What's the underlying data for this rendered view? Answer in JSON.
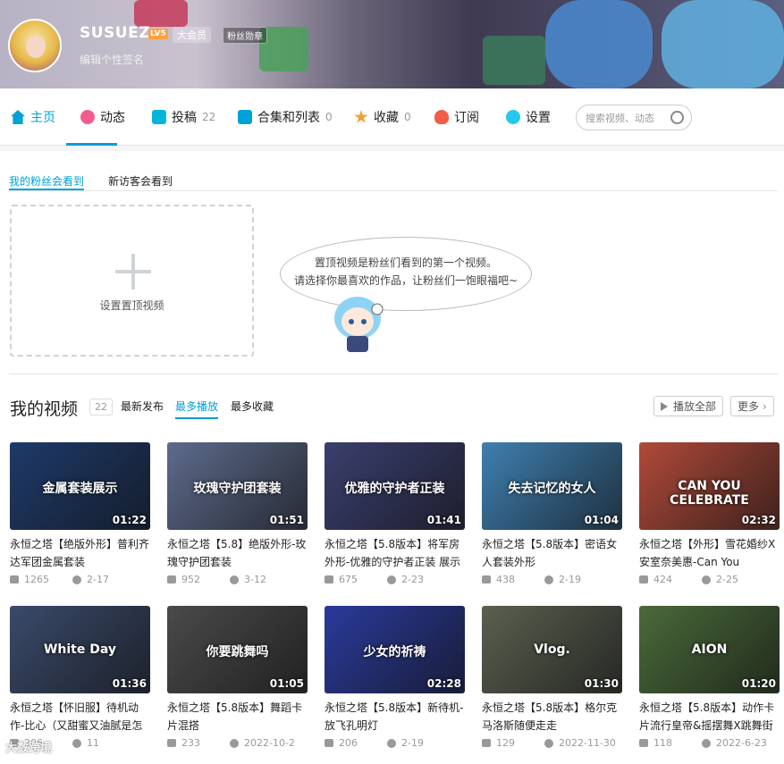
{
  "header": {
    "username": "SUSUEZ",
    "level": "LV5",
    "vip": "大会员",
    "fan_badge": "粉丝勋章",
    "signature": "编辑个性签名"
  },
  "nav": {
    "tabs": [
      {
        "label": "主页",
        "count": "",
        "color": "#00a1d6"
      },
      {
        "label": "动态",
        "count": "",
        "color": "#f25d8e"
      },
      {
        "label": "投稿",
        "count": "22",
        "color": "#02b5da"
      },
      {
        "label": "合集和列表",
        "count": "0",
        "color": "#00a1d6"
      },
      {
        "label": "收藏",
        "count": "0",
        "color": "#f3a034"
      },
      {
        "label": "订阅",
        "count": "",
        "color": "#f25d48"
      },
      {
        "label": "设置",
        "count": "",
        "color": "#23c9ed"
      }
    ],
    "search_placeholder": "搜索视频、动态"
  },
  "pin": {
    "tabs": [
      "我的粉丝会看到",
      "新访客会看到"
    ],
    "set_label": "设置置顶视频",
    "bubble_line1": "置顶视频是粉丝们看到的第一个视频。",
    "bubble_line2": "请选择你最喜欢的作品，让粉丝们一饱眼福吧~"
  },
  "videos_section": {
    "title": "我的视频",
    "count": "22",
    "sort": [
      "最新发布",
      "最多播放",
      "最多收藏"
    ],
    "play_all": "播放全部",
    "more": "更多"
  },
  "videos": [
    {
      "title": "永恒之塔【绝版外形】普利齐达军团金属套装",
      "plays": "1265",
      "date": "2-17",
      "duration": "01:22",
      "caption": "金属套装展示",
      "bg": "#1e3a6a"
    },
    {
      "title": "永恒之塔【5.8】绝版外形-玫瑰守护团套装",
      "plays": "952",
      "date": "3-12",
      "duration": "01:51",
      "caption": "玫瑰守护团套装",
      "bg": "#5d6b8c"
    },
    {
      "title": "永恒之塔【5.8版本】将军房外形-优雅的守护者正装 展示",
      "plays": "675",
      "date": "2-23",
      "duration": "01:41",
      "caption": "优雅的守护者正装",
      "bg": "#3a3f6e"
    },
    {
      "title": "永恒之塔【5.8版本】密语女人套装外形",
      "plays": "438",
      "date": "2-19",
      "duration": "01:04",
      "caption": "失去记忆的女人",
      "bg": "#3f7fb0"
    },
    {
      "title": "永恒之塔【外形】雪花婚纱X安室奈美惠-Can You",
      "plays": "424",
      "date": "2-25",
      "duration": "02:32",
      "caption": "CAN YOU CELEBRATE",
      "bg": "#b04a3a"
    },
    {
      "title": "永恒之塔【怀旧服】待机动作-比心（又甜蜜又油腻是怎",
      "plays": "206",
      "date": "11",
      "duration": "01:36",
      "caption": "White Day",
      "bg": "#3a4a6a"
    },
    {
      "title": "永恒之塔【5.8版本】舞蹈卡片混搭",
      "plays": "233",
      "date": "2022-10-2",
      "duration": "01:05",
      "caption": "你要跳舞吗",
      "bg": "#4a4a4a"
    },
    {
      "title": "永恒之塔【5.8版本】新待机-放飞孔明灯",
      "plays": "206",
      "date": "2-19",
      "duration": "02:28",
      "caption": "少女的祈祷",
      "bg": "#2a3a9a"
    },
    {
      "title": "永恒之塔【5.8版本】格尔克马洛斯随便走走",
      "plays": "129",
      "date": "2022-11-30",
      "duration": "01:30",
      "caption": "Vlog.",
      "bg": "#5a6050"
    },
    {
      "title": "永恒之塔【5.8版本】动作卡片流行皇帝&摇摆舞X跳舞街",
      "plays": "118",
      "date": "2022-6-23",
      "duration": "01:20",
      "caption": "AION",
      "bg": "#4a6a3a"
    }
  ],
  "watermark": "大数跨境"
}
